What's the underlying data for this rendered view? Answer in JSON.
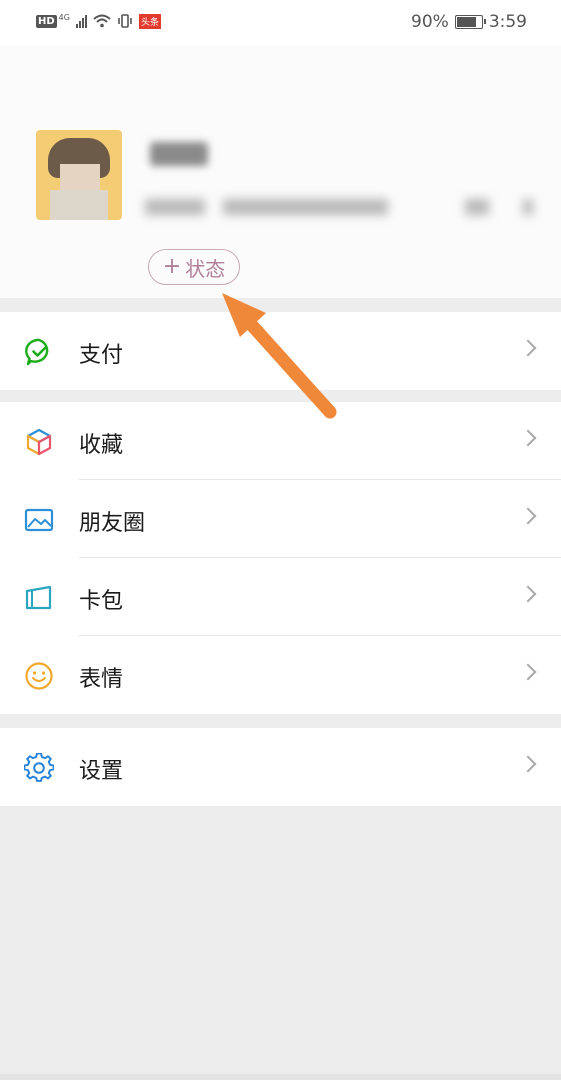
{
  "status_bar": {
    "network_hd": "HD",
    "network_gen": "4G",
    "news_badge": "头条",
    "battery_percent": "90%",
    "battery_level": 0.9,
    "time": "3:59"
  },
  "profile": {
    "status_plus": "+",
    "status_label": "状态"
  },
  "menu": {
    "pay": "支付",
    "favorites": "收藏",
    "moments": "朋友圈",
    "cards": "卡包",
    "stickers": "表情",
    "settings": "设置"
  },
  "icons": {
    "pay": "wechat-pay-icon",
    "favorites": "cube-icon",
    "moments": "picture-icon",
    "cards": "card-icon",
    "stickers": "smiley-icon",
    "settings": "gear-icon"
  },
  "colors": {
    "pay_green": "#1aad19",
    "settings_blue": "#2782d7",
    "stickers_orange": "#f0a92e",
    "moments_blue": "#2d8fd5",
    "cards_teal": "#2aa6bf",
    "status_pill": "#c9aab8",
    "annotation_arrow": "#f0883a"
  }
}
